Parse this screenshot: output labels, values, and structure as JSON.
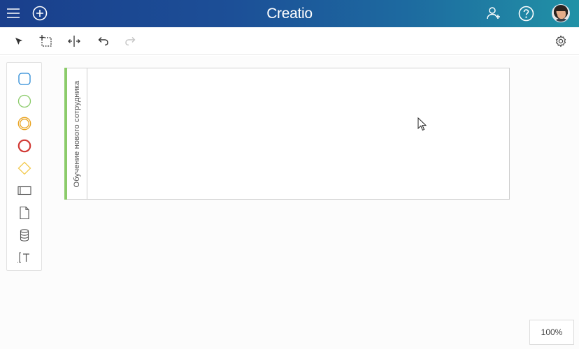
{
  "header": {
    "logo": "Creatio",
    "icons": [
      "menu-icon",
      "add-circle-icon",
      "add-user-icon",
      "help-icon",
      "avatar"
    ]
  },
  "toolbar": {
    "tools": [
      "pointer-icon",
      "lasso-select-icon",
      "space-tool-icon",
      "undo-icon",
      "redo-icon"
    ],
    "settings_icon": "gear-icon"
  },
  "palette": {
    "items": [
      "user-task-icon",
      "start-event-icon",
      "intermediate-event-icon",
      "end-event-icon",
      "gateway-icon",
      "subprocess-icon",
      "data-object-icon",
      "data-store-icon",
      "annotation-icon"
    ],
    "colors": {
      "task": "#2b8ad6",
      "start": "#8bcb6a",
      "intermediate": "#e9a320",
      "end": "#d13a35",
      "gateway": "#f2c94c"
    }
  },
  "pool": {
    "title": "Обучение нового сотрудника",
    "accent_color": "#8bcb6a"
  },
  "zoom": {
    "level": "100%"
  }
}
